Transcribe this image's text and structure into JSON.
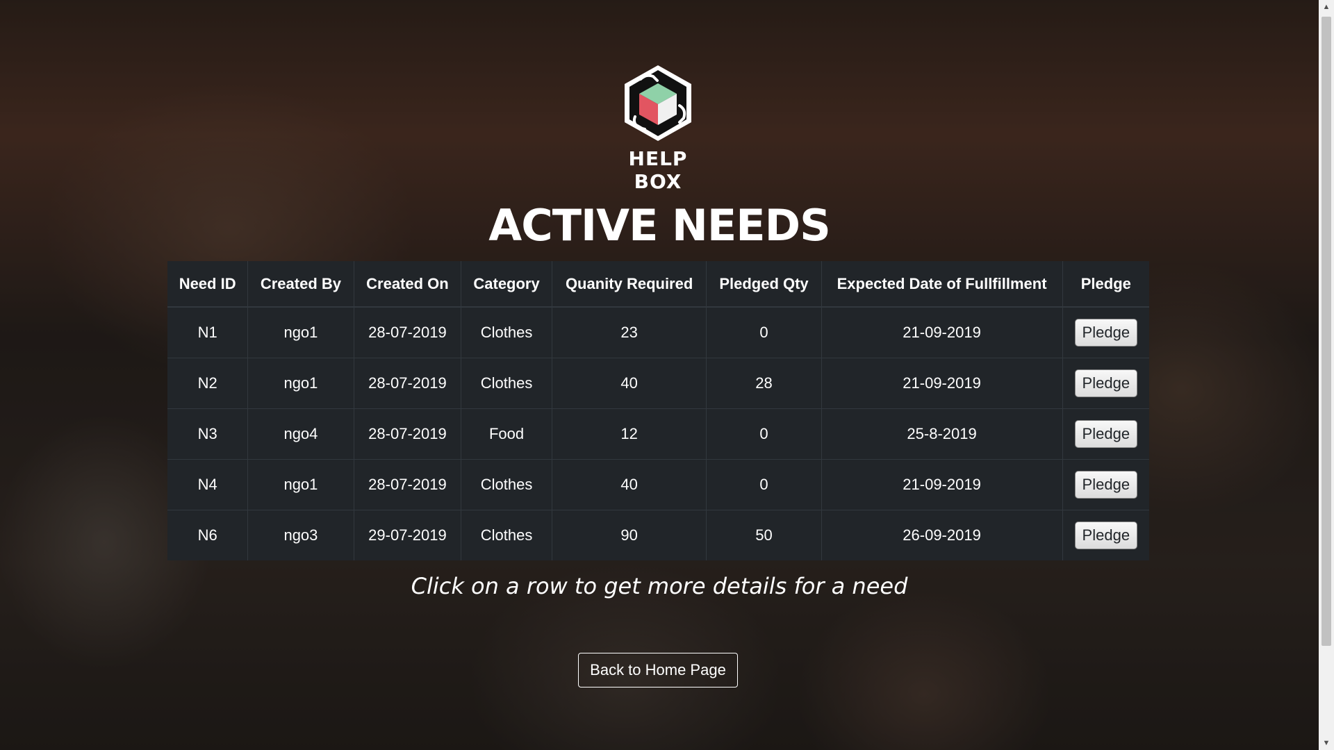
{
  "logo": {
    "text": "HELP BOX"
  },
  "page": {
    "title": "ACTIVE NEEDS",
    "hint": "Click on a row to get more details for a need",
    "home_button": "Back to Home Page"
  },
  "table": {
    "headers": [
      "Need ID",
      "Created By",
      "Created On",
      "Category",
      "Quanity Required",
      "Pledged Qty",
      "Expected Date of Fullfillment",
      "Pledge"
    ],
    "rows": [
      {
        "id": "N1",
        "created_by": "ngo1",
        "created_on": "28-07-2019",
        "category": "Clothes",
        "qty": "23",
        "pledged": "0",
        "expected": "21-09-2019",
        "action": "Pledge"
      },
      {
        "id": "N2",
        "created_by": "ngo1",
        "created_on": "28-07-2019",
        "category": "Clothes",
        "qty": "40",
        "pledged": "28",
        "expected": "21-09-2019",
        "action": "Pledge"
      },
      {
        "id": "N3",
        "created_by": "ngo4",
        "created_on": "28-07-2019",
        "category": "Food",
        "qty": "12",
        "pledged": "0",
        "expected": "25-8-2019",
        "action": "Pledge"
      },
      {
        "id": "N4",
        "created_by": "ngo1",
        "created_on": "28-07-2019",
        "category": "Clothes",
        "qty": "40",
        "pledged": "0",
        "expected": "21-09-2019",
        "action": "Pledge"
      },
      {
        "id": "N6",
        "created_by": "ngo3",
        "created_on": "29-07-2019",
        "category": "Clothes",
        "qty": "90",
        "pledged": "50",
        "expected": "26-09-2019",
        "action": "Pledge"
      }
    ]
  },
  "colors": {
    "table_bg": "#212529",
    "table_border": "#32383e",
    "logo_green": "#8fd1a8",
    "logo_red": "#e25561",
    "text": "#ffffff"
  },
  "icons": {
    "logo": "help-box-hands-cube-icon",
    "scroll_up": "chevron-up-icon",
    "scroll_down": "chevron-down-icon"
  }
}
